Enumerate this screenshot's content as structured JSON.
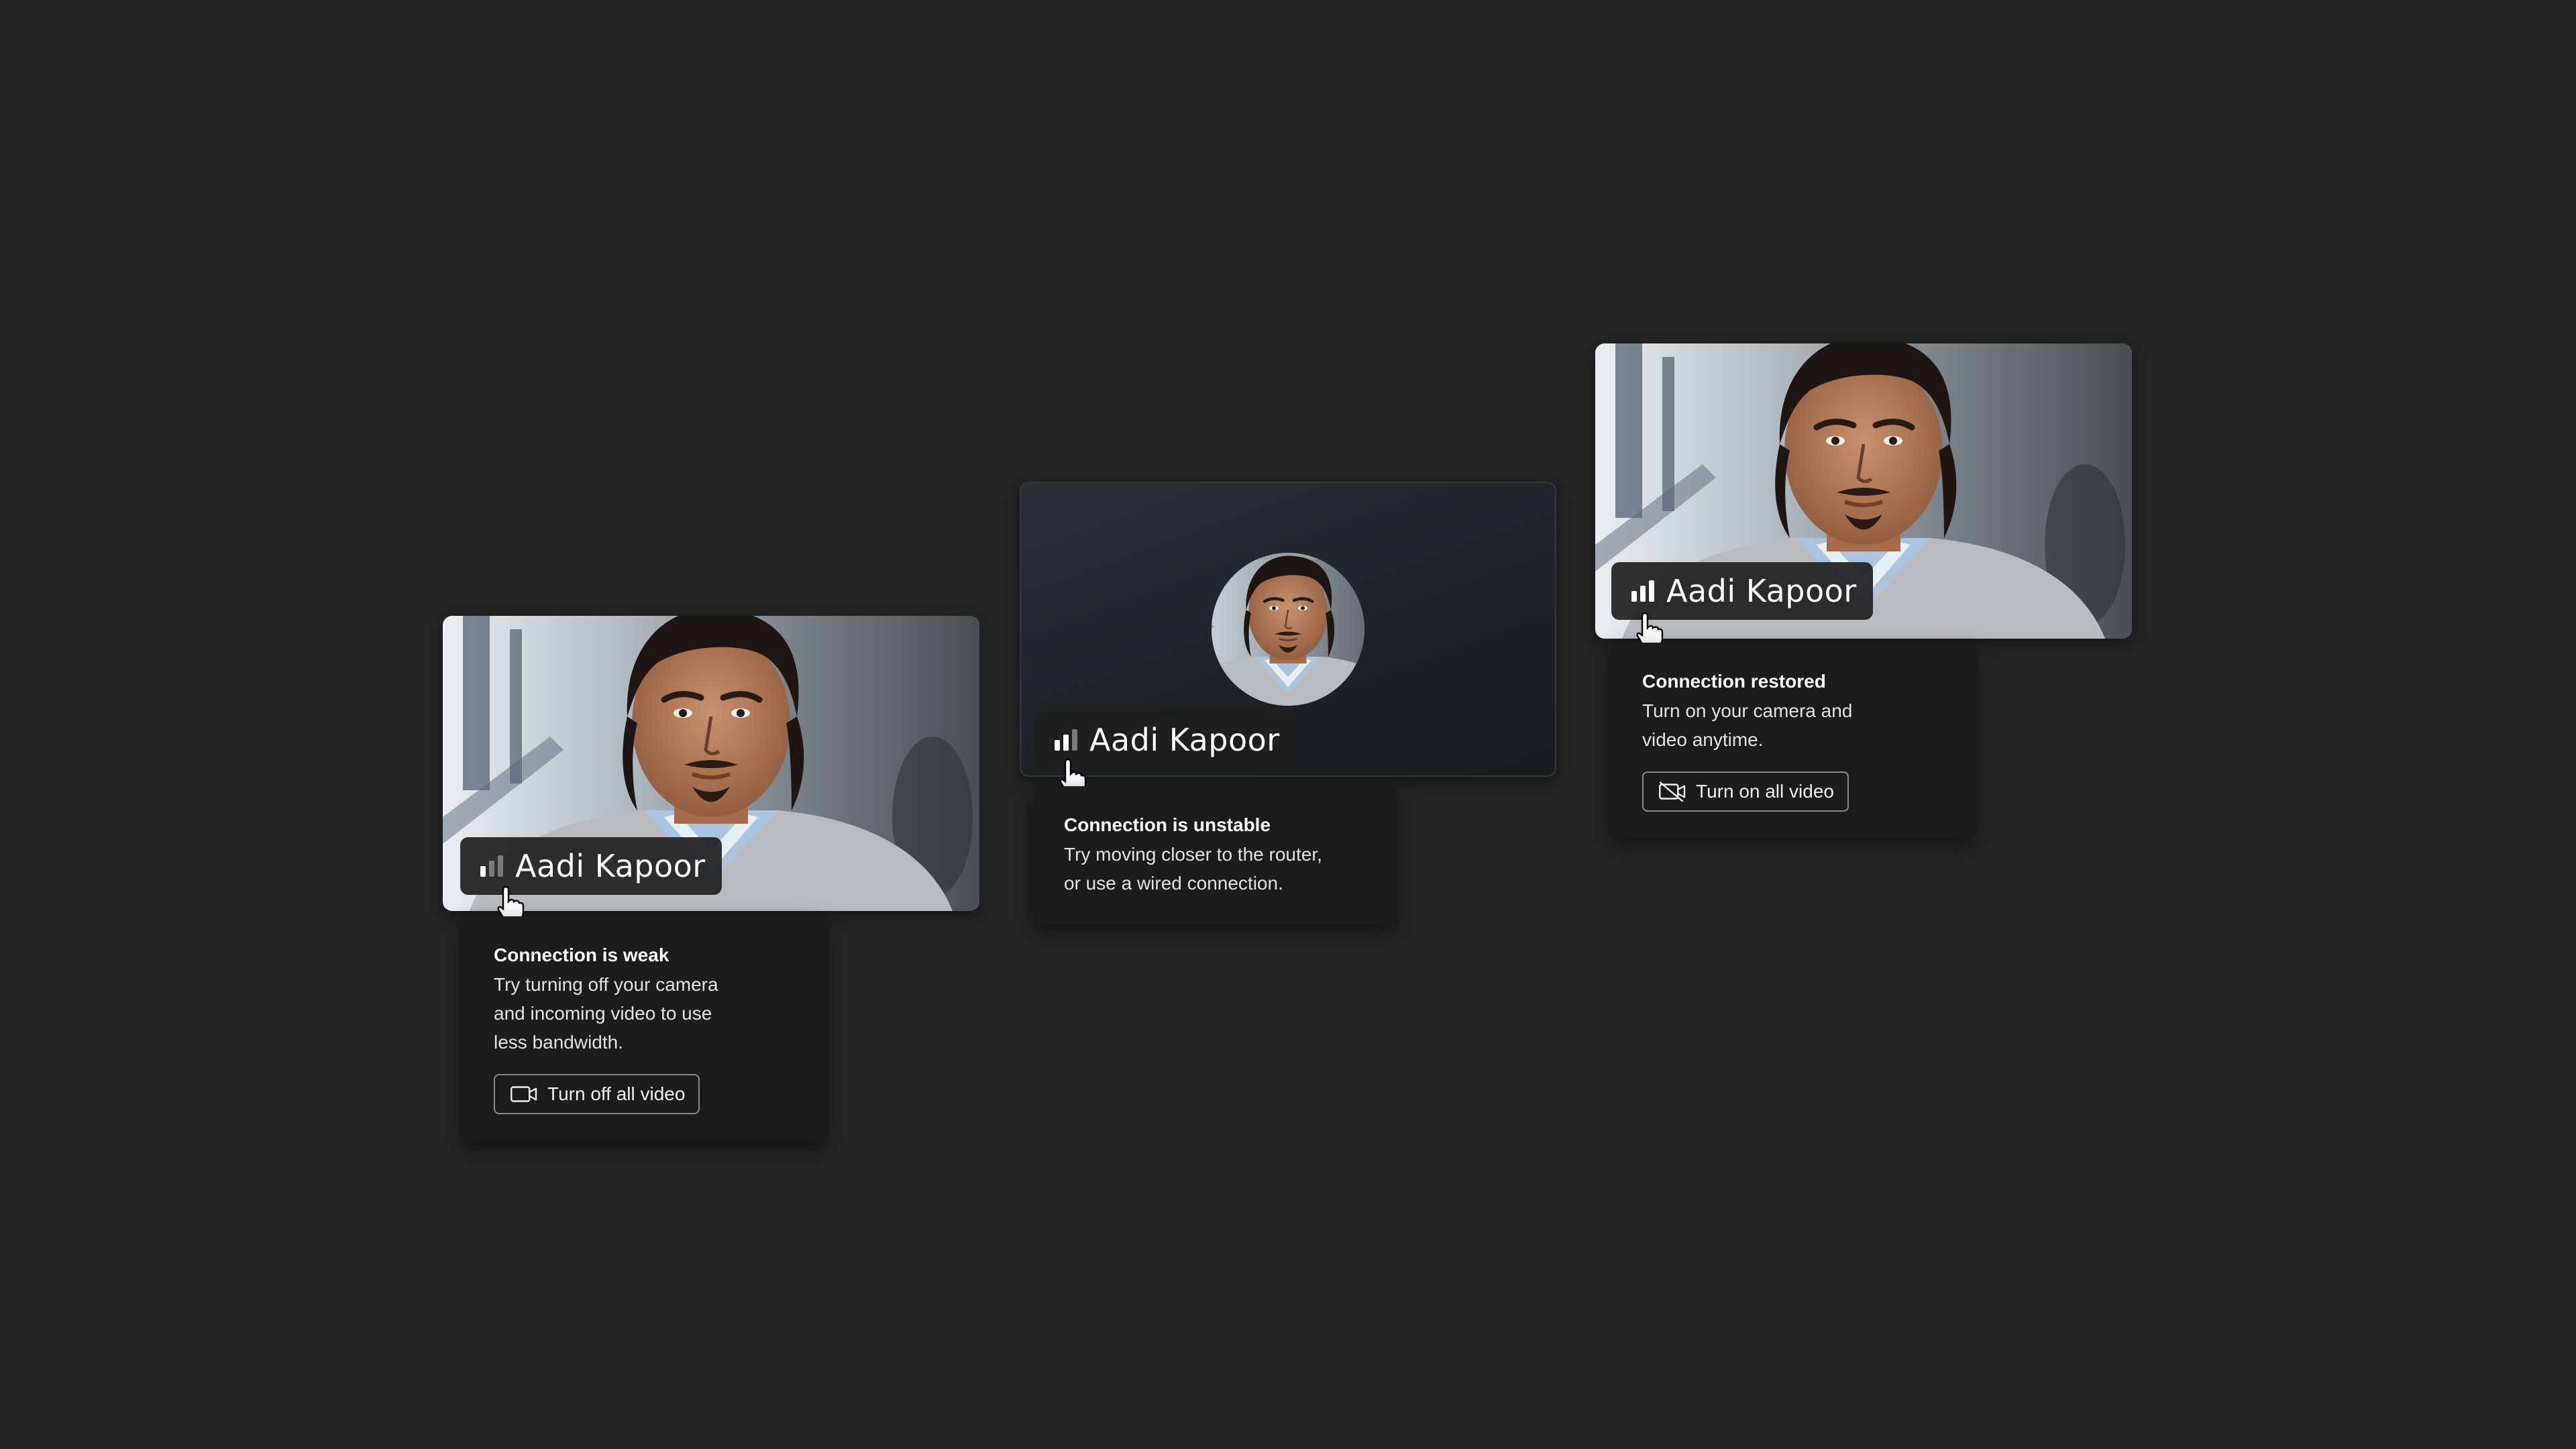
{
  "colors": {
    "background": "#262626",
    "bar_active": "#ffffff",
    "bar_inactive": "#7a7a7a"
  },
  "cards": [
    {
      "participant_name": "Aadi Kapoor",
      "signal_level": "1 of 3 bars",
      "status_title": "Connection is weak",
      "status_body": "Try turning off your camera\nand incoming video to use\nless bandwidth.",
      "action_label": "Turn off all video",
      "action_icon": "video-camera-icon"
    },
    {
      "participant_name": "Aadi Kapoor",
      "signal_level": "2 of 3 bars",
      "status_title": "Connection is unstable",
      "status_body": "Try moving closer to the router,\nor use a wired connection."
    },
    {
      "participant_name": "Aadi Kapoor",
      "signal_level": "3 of 3 bars",
      "status_title": "Connection restored",
      "status_body": "Turn on your camera and\nvideo anytime.",
      "action_label": "Turn on all video",
      "action_icon": "video-camera-off-icon"
    }
  ]
}
